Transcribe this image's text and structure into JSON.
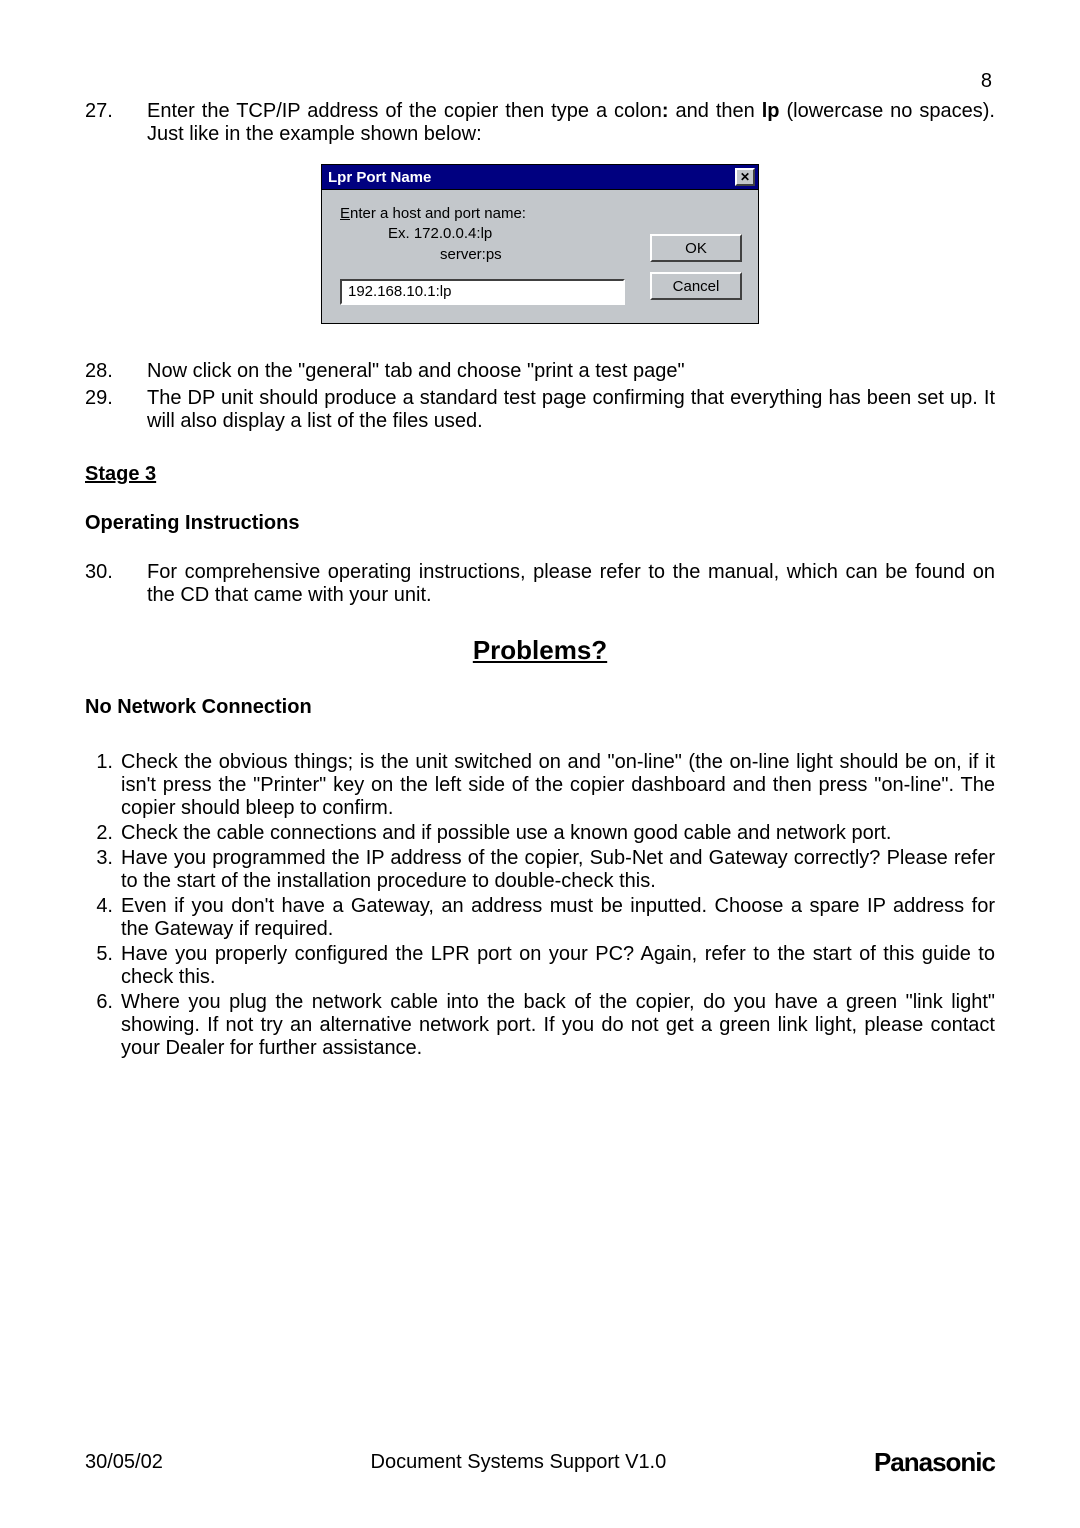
{
  "page_number": "8",
  "steps": {
    "s27": {
      "num": "27.",
      "pre": "Enter the TCP/IP address of the copier then type a colon",
      "colon_bold": ":",
      "mid": " and then ",
      "lp": "lp",
      "post": " (lowercase no spaces). Just like in the example shown below:"
    },
    "s28": {
      "num": "28.",
      "text": "Now click on the \"general\" tab and choose \"print a test page\""
    },
    "s29": {
      "num": "29.",
      "text": "The DP unit should produce a standard test page confirming that everything has been set up. It will also display a list of the files used."
    }
  },
  "dialog": {
    "title": "Lpr Port Name",
    "close_glyph": "✕",
    "label_pre_u": "E",
    "label_post_u": "nter a host and port name:",
    "example_1": "Ex.  172.0.0.4:lp",
    "example_2": "server:ps",
    "input_value": "192.168.10.1:lp",
    "ok": "OK",
    "cancel": "Cancel"
  },
  "stage3": {
    "heading": "Stage 3",
    "subheading": "Operating Instructions",
    "s30": {
      "num": "30.",
      "text": "For comprehensive operating instructions, please refer to the manual, which can be found on the CD that came with your unit."
    }
  },
  "problems_heading": "Problems?",
  "nnc_heading": "No Network Connection",
  "troubleshoot": [
    {
      "n": "1.",
      "t": "Check the obvious things; is the unit switched on and \"on-line\" (the on-line light should be on, if it isn't press the \"Printer\" key on the left side of the copier dashboard and then press \"on-line\". The copier should bleep to confirm."
    },
    {
      "n": "2.",
      "t": "Check the cable connections and if possible use a known good cable and network port."
    },
    {
      "n": "3.",
      "t": "Have you programmed the IP address of the copier, Sub-Net and Gateway correctly? Please refer to the start of the installation procedure to double-check this."
    },
    {
      "n": "4.",
      "t": "Even if you don't have a Gateway, an address must be inputted. Choose a spare IP address for the Gateway if required."
    },
    {
      "n": "5.",
      "t": "Have you properly configured the LPR port on your PC? Again, refer to the start of this guide to check this."
    },
    {
      "n": "6.",
      "t": "Where you plug the network cable into the back of the copier, do you have a green \"link light\" showing. If not try an alternative network port. If you do not get a green link light, please contact your Dealer for further assistance."
    }
  ],
  "footer": {
    "date": "30/05/02",
    "center": "Document Systems Support V1.0",
    "brand": "Panasonic"
  }
}
